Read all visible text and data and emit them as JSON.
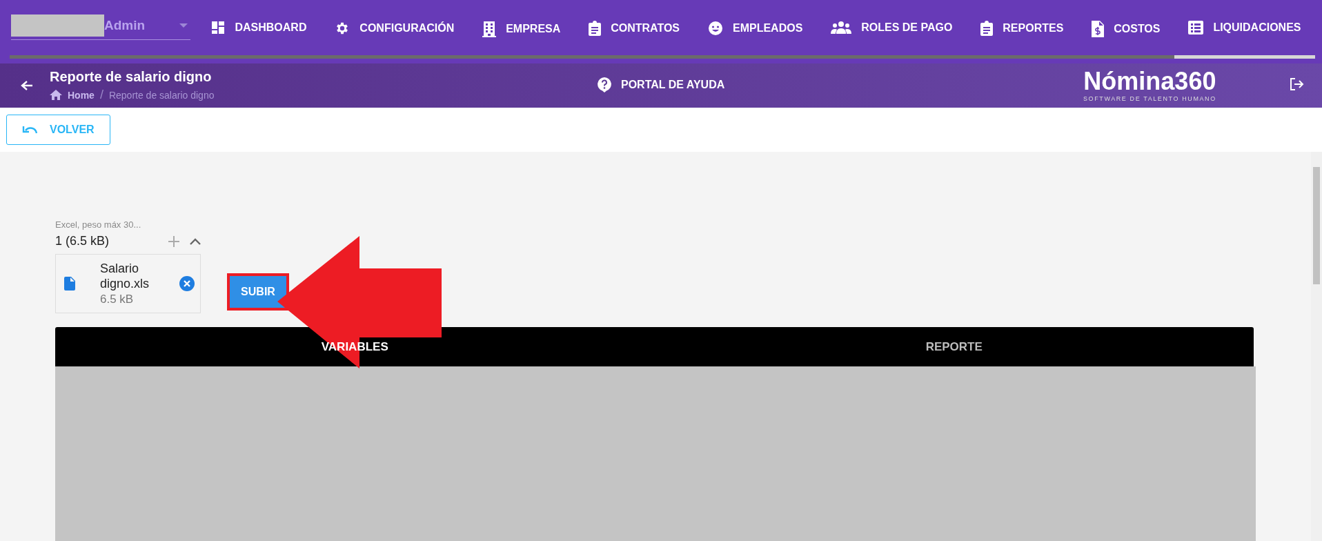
{
  "user_menu": {
    "value": "Admin"
  },
  "nav": [
    {
      "label": "DASHBOARD",
      "selected": false
    },
    {
      "label": "CONFIGURACIÓN",
      "selected": false
    },
    {
      "label": "EMPRESA",
      "selected": false
    },
    {
      "label": "CONTRATOS",
      "selected": false
    },
    {
      "label": "EMPLEADOS",
      "selected": false
    },
    {
      "label": "ROLES DE PAGO",
      "selected": false
    },
    {
      "label": "REPORTES",
      "selected": false
    },
    {
      "label": "COSTOS",
      "selected": false
    },
    {
      "label": "LIQUIDACIONES",
      "selected": true
    }
  ],
  "header": {
    "title": "Reporte de salario digno",
    "breadcrumb": [
      "Home",
      "/",
      "Reporte de salario digno"
    ],
    "help": "PORTAL DE AYUDA",
    "logo": {
      "name": "Nómina360",
      "tagline": "SOFTWARE DE TALENTO HUMANO"
    }
  },
  "toolbar": {
    "back_button": "VOLVER"
  },
  "upload": {
    "hint": "Excel, peso máx 30...",
    "summary": "1 (6.5 kB)",
    "files": [
      {
        "name": "Salario digno.xls",
        "size": "6.5 kB"
      }
    ],
    "button": "SUBIR"
  },
  "tabs": [
    {
      "label": "VARIABLES",
      "selected": true
    },
    {
      "label": "REPORTE",
      "selected": false
    }
  ]
}
